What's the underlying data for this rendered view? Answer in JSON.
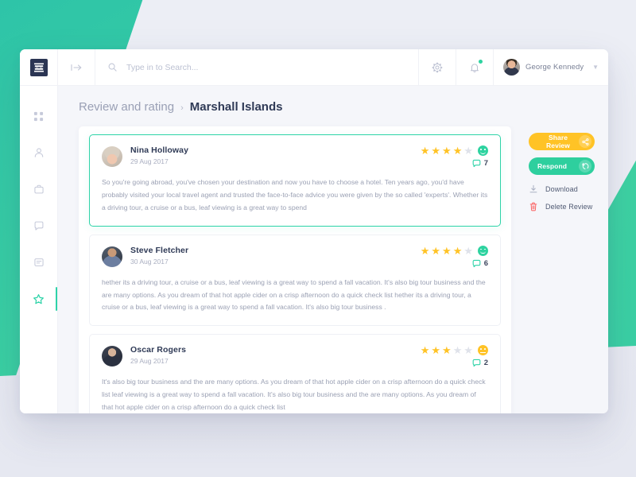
{
  "topbar": {
    "logo_name": "app-logo",
    "collapse_icon": "collapse-arrow-icon",
    "search": {
      "placeholder": "Type in to Search...",
      "value": "",
      "icon": "search-icon"
    },
    "settings_icon": "gear-icon",
    "notifications_icon": "bell-icon",
    "notification_badge": true,
    "user": {
      "name": "George Kennedy",
      "avatar": "user-avatar",
      "caret": "chevron-down-icon"
    }
  },
  "sidebar": {
    "items": [
      {
        "name": "dashboard",
        "icon": "grid-icon",
        "active": false
      },
      {
        "name": "users",
        "icon": "user-icon",
        "active": false
      },
      {
        "name": "jobs",
        "icon": "briefcase-icon",
        "active": false
      },
      {
        "name": "chat",
        "icon": "chat-bubble-icon",
        "active": false
      },
      {
        "name": "messages",
        "icon": "message-card-icon",
        "active": false
      },
      {
        "name": "reviews",
        "icon": "star-icon",
        "active": true
      }
    ]
  },
  "breadcrumb": {
    "parent": "Review and rating",
    "separator": "›",
    "current": "Marshall Islands"
  },
  "reviews": [
    {
      "name": "Nina Holloway",
      "date": "29 Aug 2017",
      "rating": 4,
      "max_rating": 5,
      "mood": "happy",
      "comments": "7",
      "selected": true,
      "text": "So you're going abroad, you've chosen your destination and now you have to choose a hotel. Ten years ago, you'd have probably visited your local travel agent and trusted the face-to-face advice you were given by the so called 'experts'. Whether its a driving tour, a cruise or a bus, leaf viewing is a great way to spend"
    },
    {
      "name": "Steve Fletcher",
      "date": "30 Aug 2017",
      "rating": 4,
      "max_rating": 5,
      "mood": "happy",
      "comments": "6",
      "selected": false,
      "text": "hether its a driving tour, a cruise or a bus, leaf viewing is a great way to spend a fall vacation. It's also big tour business and the are many options. As you dream of that hot apple cider on a crisp afternoon do a quick check list hether its a driving tour, a cruise or a bus, leaf viewing is a great way to spend a fall vacation. It's also big tour business ."
    },
    {
      "name": "Oscar Rogers",
      "date": "29 Aug 2017",
      "rating": 3,
      "max_rating": 5,
      "mood": "neutral",
      "comments": "2",
      "selected": false,
      "text": "It's also big tour business and the are many options. As you dream of that hot apple cider on a crisp afternoon do a quick check list leaf viewing is a great way to spend a fall vacation. It's also big tour business and the are many options. As you dream of that hot apple cider on a crisp afternoon do a quick check list"
    }
  ],
  "actions": {
    "share": {
      "label": "Share Review",
      "icon": "share-icon"
    },
    "respond": {
      "label": "Respond",
      "icon": "reply-icon"
    },
    "download": {
      "label": "Download",
      "icon": "download-icon"
    },
    "delete": {
      "label": "Delete Review",
      "icon": "trash-icon"
    }
  },
  "colors": {
    "accent_green": "#2ed3a8",
    "accent_yellow": "#ffc326",
    "danger_red": "#fa6a6a",
    "text_dark": "#2f3a56",
    "text_muted": "#9ba1b4",
    "page_bg": "#eceef5",
    "content_bg": "#f5f6fa"
  }
}
